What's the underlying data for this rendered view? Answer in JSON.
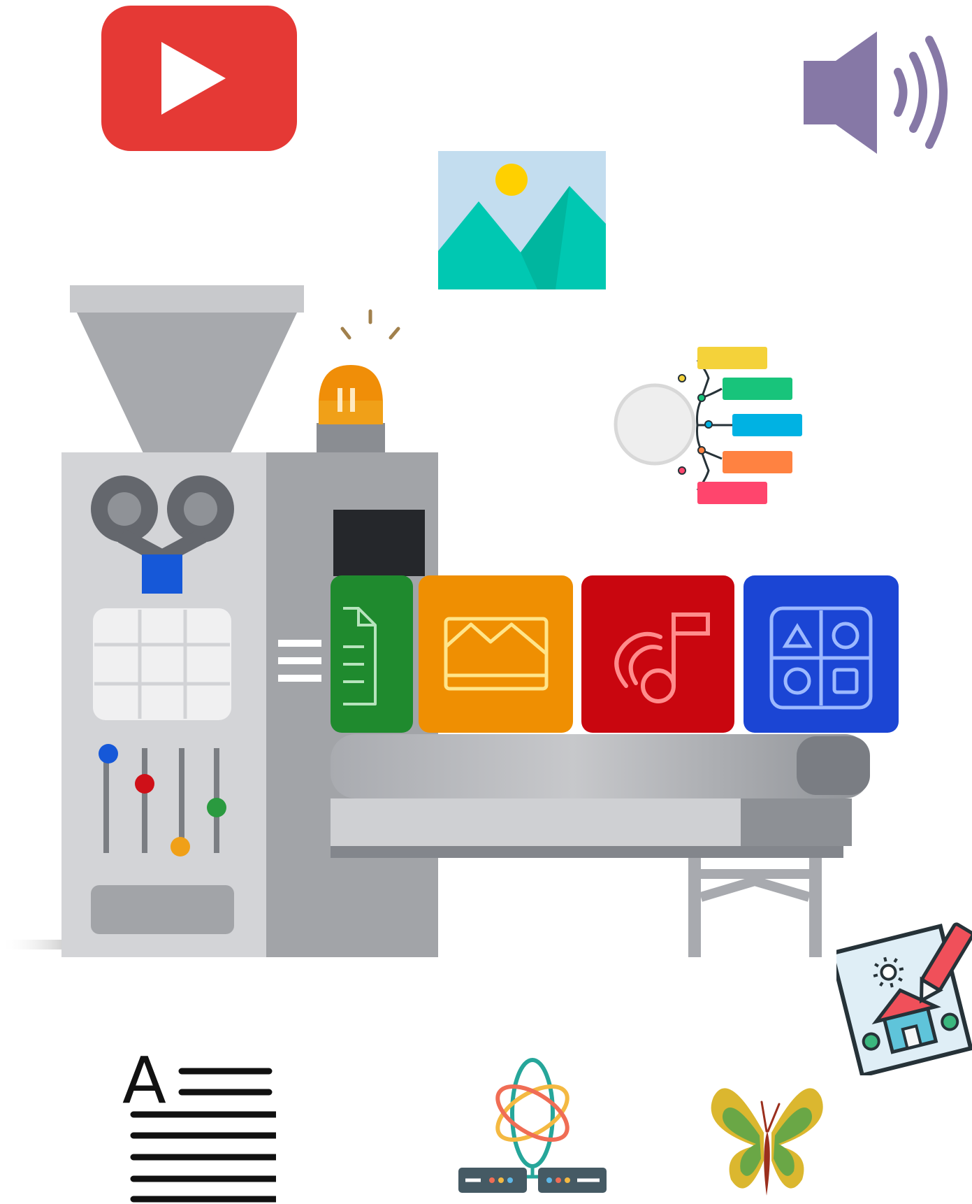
{
  "scene": {
    "background": "#ffffff",
    "text_document_icon": {
      "glyph": "A"
    }
  },
  "colors": {
    "red": "#e53935",
    "purple": "#8678a6",
    "sky": "#c3ddef",
    "sun": "#ffd000",
    "teal": "#00c8b2",
    "yellow": "#f4d23a",
    "green": "#18c47b",
    "blue": "#00b2e3",
    "orange": "#ff8241",
    "pink": "#ff456d",
    "machine_light": "#d0d1d5",
    "machine_mid": "#a2a4a8",
    "machine_dark": "#6f7278",
    "box_green": "#1f8a2e",
    "box_orange": "#ef8f02",
    "box_red": "#c9060f",
    "box_blue": "#1b45d4"
  },
  "icons": [
    "video-play-icon",
    "speaker-icon",
    "image-icon",
    "mind-map-icon",
    "content-machine",
    "document-box-icon",
    "image-box-icon",
    "music-box-icon",
    "shapes-box-icon",
    "drawing-icon",
    "text-document-icon",
    "network-icon",
    "butterfly-icon"
  ]
}
